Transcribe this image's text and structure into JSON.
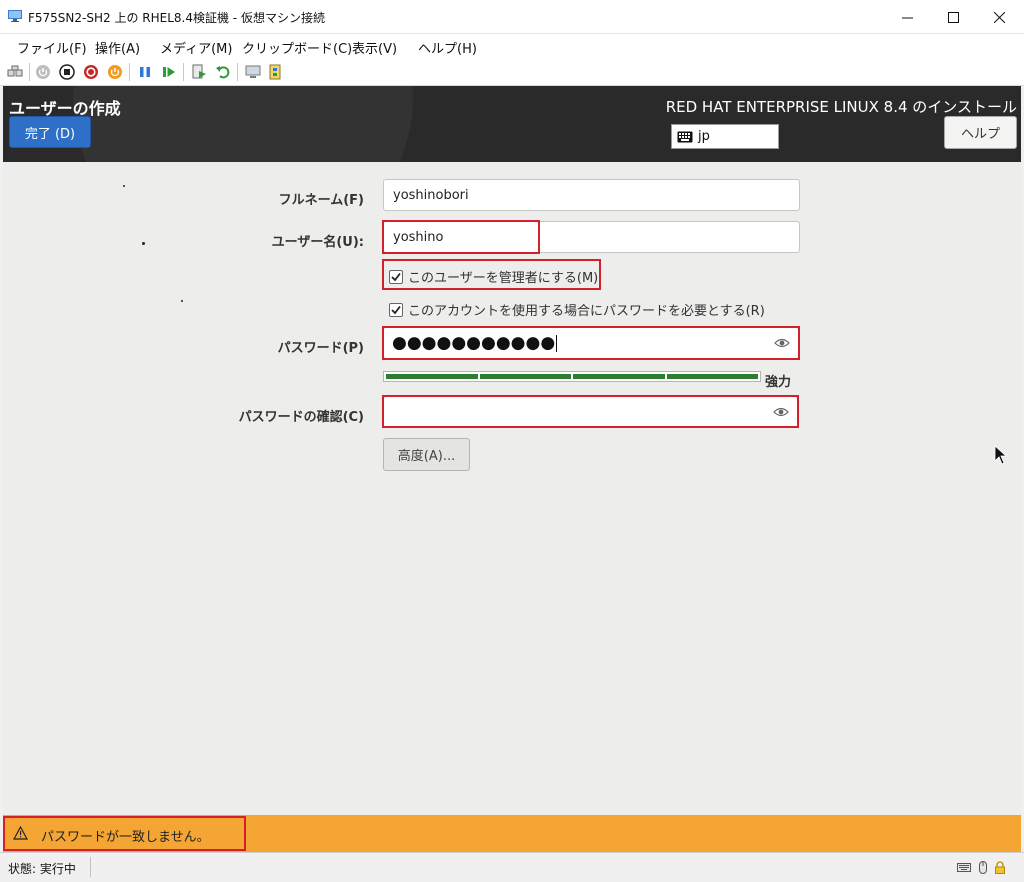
{
  "window": {
    "title": "F575SN2-SH2 上の RHEL8.4検証機 - 仮想マシン接続"
  },
  "menu": [
    "ファイル(F)",
    "操作(A)",
    "メディア(M)",
    "クリップボード(C)",
    "表示(V)",
    "ヘルプ(H)"
  ],
  "toolbar": {
    "icons": [
      "ctrl-alt-del-icon",
      "start-icon",
      "turn-off-icon",
      "shutdown-icon",
      "save-icon",
      "pause-icon",
      "reset-icon",
      "checkpoint-icon",
      "revert-icon",
      "enhanced-session-icon",
      "share-icon"
    ]
  },
  "installer": {
    "screen_title": "ユーザーの作成",
    "done_button": "完了 (D)",
    "product_title": "RED HAT ENTERPRISE LINUX 8.4 のインストール",
    "keyboard_layout": "jp",
    "help_button": "ヘルプ"
  },
  "form": {
    "fullname_label": "フルネーム(F)",
    "fullname_value": "yoshinobori",
    "username_label": "ユーザー名(U):",
    "username_value": "yoshino",
    "admin_checkbox_label": "このユーザーを管理者にする(M)",
    "admin_checked": true,
    "require_password_label": "このアカウントを使用する場合にパスワードを必要とする(R)",
    "require_password_checked": true,
    "password_label": "パスワード(P)",
    "password_masked": "●●●●●●●●●●●",
    "strength_fraction": 1.0,
    "strength_label": "強力",
    "confirm_label": "パスワードの確認(C)",
    "confirm_value": "",
    "advanced_button": "高度(A)..."
  },
  "warning": {
    "message": "パスワードが一致しません。"
  },
  "status": {
    "text": "状態: 実行中"
  },
  "colors": {
    "warning_bar": "#f5a533",
    "done_button": "#2e6fc7",
    "highlight_box": "#d3202a",
    "strength_fill": "#2f7d32"
  }
}
